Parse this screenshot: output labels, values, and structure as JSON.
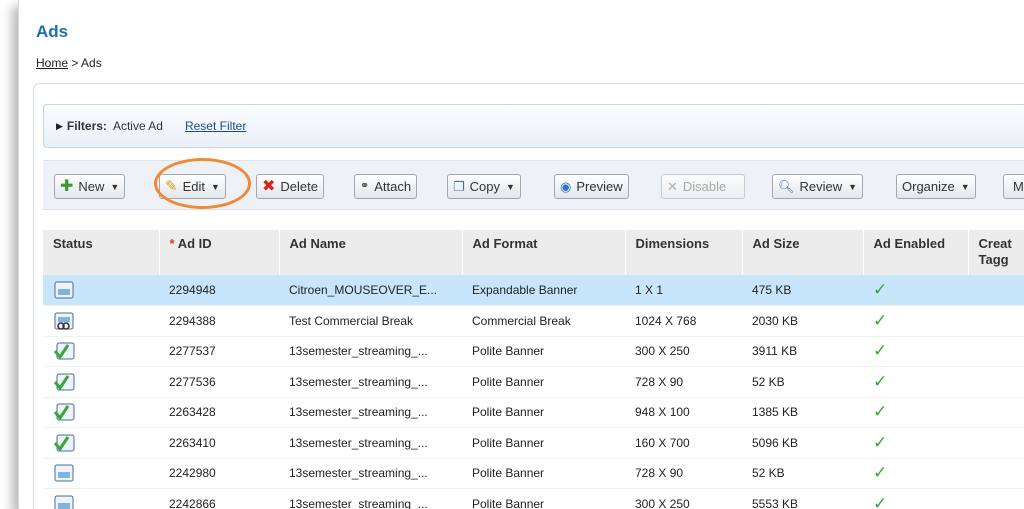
{
  "page": {
    "title": "Ads"
  },
  "breadcrumb": {
    "home": "Home",
    "separator": ">",
    "current": "Ads"
  },
  "filters": {
    "label": "Filters:",
    "value": "Active Ad",
    "reset": "Reset Filter"
  },
  "toolbar": {
    "new": "New",
    "edit": "Edit",
    "delete": "Delete",
    "attach": "Attach",
    "copy": "Copy",
    "preview": "Preview",
    "disable": "Disable",
    "review": "Review",
    "organize": "Organize",
    "more": "M"
  },
  "colors": {
    "accent": "#1f6fb7",
    "selected_row": "#c8e6fb",
    "highlight_ring": "#ef8a36",
    "check": "#38a52f"
  },
  "table": {
    "headers": {
      "status": "Status",
      "ad_id_required": "*",
      "ad_id": "Ad ID",
      "ad_name": "Ad Name",
      "ad_format": "Ad Format",
      "dimensions": "Dimensions",
      "ad_size": "Ad Size",
      "ad_enabled": "Ad Enabled",
      "created_line1": "Creat",
      "created_line2": "Tagg"
    },
    "rows": [
      {
        "status_icon": "banner-icon",
        "id": "2294948",
        "name": "Citroen_MOUSEOVER_E...",
        "format": "Expandable Banner",
        "dimensions": "1 X 1",
        "size": "475 KB",
        "enabled": "✓",
        "created": ""
      },
      {
        "status_icon": "banner-attached-icon",
        "id": "2294388",
        "name": "Test Commercial Break",
        "format": "Commercial Break",
        "dimensions": "1024 X 768",
        "size": "2030 KB",
        "enabled": "✓",
        "created": ""
      },
      {
        "status_icon": "banner-approved-icon",
        "id": "2277537",
        "name": "13semester_streaming_...",
        "format": "Polite Banner",
        "dimensions": "300 X 250",
        "size": "3911 KB",
        "enabled": "✓",
        "created": ""
      },
      {
        "status_icon": "banner-approved-icon",
        "id": "2277536",
        "name": "13semester_streaming_...",
        "format": "Polite Banner",
        "dimensions": "728 X 90",
        "size": "52 KB",
        "enabled": "✓",
        "created": ""
      },
      {
        "status_icon": "banner-approved-icon",
        "id": "2263428",
        "name": "13semester_streaming_...",
        "format": "Polite Banner",
        "dimensions": "948 X 100",
        "size": "1385 KB",
        "enabled": "✓",
        "created": ""
      },
      {
        "status_icon": "banner-approved-icon",
        "id": "2263410",
        "name": "13semester_streaming_...",
        "format": "Polite Banner",
        "dimensions": "160 X 700",
        "size": "5096 KB",
        "enabled": "✓",
        "created": ""
      },
      {
        "status_icon": "banner-icon",
        "id": "2242980",
        "name": "13semester_streaming_...",
        "format": "Polite Banner",
        "dimensions": "728 X 90",
        "size": "52 KB",
        "enabled": "✓",
        "created": ""
      },
      {
        "status_icon": "banner-icon",
        "id": "2242866",
        "name": "13semester_streaming_...",
        "format": "Polite Banner",
        "dimensions": "300 X 250",
        "size": "5553 KB",
        "enabled": "✓",
        "created": ""
      }
    ]
  }
}
